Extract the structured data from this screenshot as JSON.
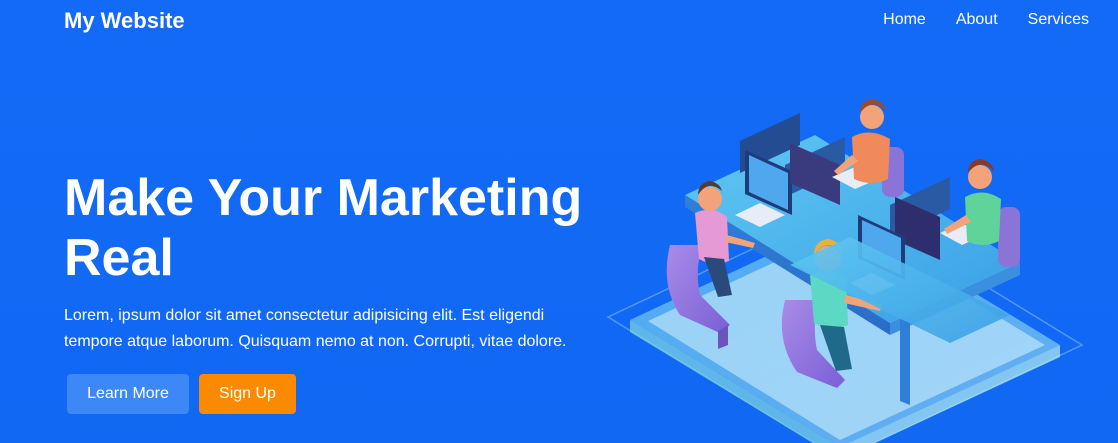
{
  "header": {
    "logo": "My Website",
    "nav": [
      {
        "label": "Home"
      },
      {
        "label": "About"
      },
      {
        "label": "Services"
      }
    ]
  },
  "hero": {
    "title": "Make Your Marketing Real",
    "description": "Lorem, ipsum dolor sit amet consectetur adipisicing elit. Est eligendi tempore atque laborum. Quisquam nemo at non. Corrupti, vitae dolore.",
    "primary_button": "Learn More",
    "secondary_button": "Sign Up"
  },
  "colors": {
    "background": "#1269f5",
    "primary_button": "#3d88f7",
    "secondary_button": "#fb8a00",
    "text": "#ffffff"
  },
  "illustration": {
    "icon": "isometric-office-workers-illustration"
  }
}
